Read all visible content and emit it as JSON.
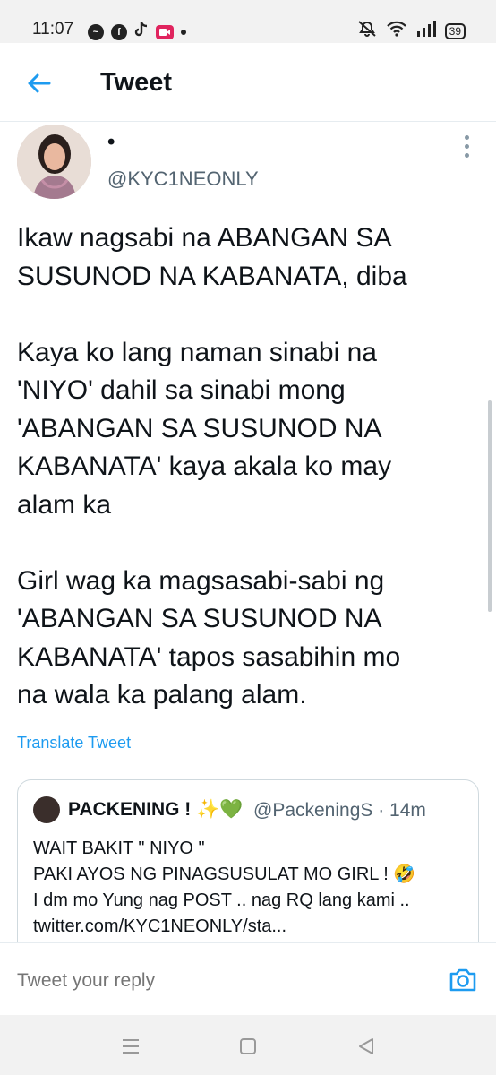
{
  "status_bar": {
    "time": "11:07",
    "battery": "39",
    "icons": [
      "messenger-icon",
      "facebook-icon",
      "tiktok-icon",
      "screen-record-icon",
      "notification-dot",
      "mute-icon",
      "wifi-icon",
      "signal-icon",
      "battery-icon"
    ]
  },
  "header": {
    "title": "Tweet",
    "accent_color": "#1d9bf0"
  },
  "tweet": {
    "display_name": "•",
    "handle": "@KYC1NEONLY",
    "paragraphs": [
      [
        "Ikaw nagsabi na ABANGAN SA",
        "SUSUNOD NA KABANATA, diba"
      ],
      [
        "Kaya ko lang naman sinabi na",
        "'NIYO' dahil sa sinabi mong",
        "'ABANGAN SA SUSUNOD NA",
        "KABANATA' kaya akala ko may",
        "alam ka"
      ],
      [
        "Girl wag ka magsasabi-sabi ng",
        "'ABANGAN SA SUSUNOD NA",
        "KABANATA' tapos sasabihin mo",
        "na  wala ka palang alam."
      ]
    ],
    "translate_label": "Translate Tweet"
  },
  "quote": {
    "display_name": "PACKENING ! ✨💚",
    "handle_time": "@PackeningS · 14m",
    "lines": [
      "WAIT BAKIT \" NIYO \"",
      "PAKI AYOS NG PINAGSUSULAT MO GIRL ! 🤣",
      "I dm mo Yung nag POST .. nag RQ lang kami ..",
      "twitter.com/KYC1NEONLY/sta..."
    ]
  },
  "reply": {
    "placeholder": "Tweet your reply"
  },
  "nav": {
    "buttons": [
      "recents-button",
      "home-button",
      "back-button"
    ]
  }
}
